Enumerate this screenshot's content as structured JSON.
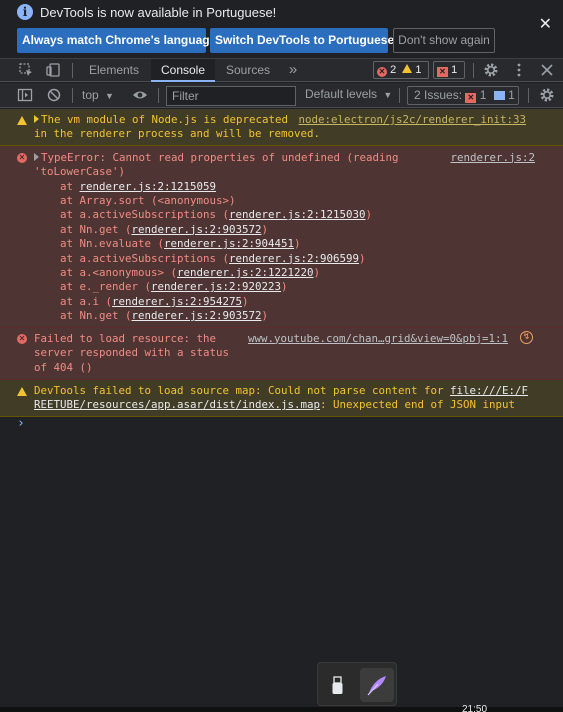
{
  "infobar": {
    "message": "DevTools is now available in Portuguese!",
    "buttons": {
      "always_match": "Always match Chrome's language",
      "switch": "Switch DevTools to Portuguese",
      "dont_show": "Don't show again"
    }
  },
  "tabs": {
    "elements": "Elements",
    "console": "Console",
    "sources": "Sources",
    "more": "»"
  },
  "counts": {
    "errors": "2",
    "warnings": "1",
    "issues_errors": "1"
  },
  "toolbar": {
    "context": "top",
    "filter_placeholder": "Filter",
    "levels": "Default levels",
    "issues_label": "2 Issues:",
    "issues_err": "1",
    "issues_info": "1"
  },
  "messages": {
    "vm_warning": {
      "text_line1": "The vm module of Node.js is deprecated",
      "text_line2": "in the renderer process and will be removed.",
      "source": "node:electron/js2c/renderer_init:33"
    },
    "type_error": {
      "line1": "TypeError: Cannot read properties of undefined (reading",
      "line2": "'toLowerCase')",
      "source": "renderer.js:2",
      "stack": [
        {
          "prefix": "at ",
          "link": "renderer.js:2:1215059",
          "suffix": ""
        },
        {
          "prefix": "at Array.sort (<anonymous>)",
          "link": "",
          "suffix": ""
        },
        {
          "prefix": "at a.activeSubscriptions (",
          "link": "renderer.js:2:1215030",
          "suffix": ")"
        },
        {
          "prefix": "at Nn.get (",
          "link": "renderer.js:2:903572",
          "suffix": ")"
        },
        {
          "prefix": "at Nn.evaluate (",
          "link": "renderer.js:2:904451",
          "suffix": ")"
        },
        {
          "prefix": "at a.activeSubscriptions (",
          "link": "renderer.js:2:906599",
          "suffix": ")"
        },
        {
          "prefix": "at a.<anonymous> (",
          "link": "renderer.js:2:1221220",
          "suffix": ")"
        },
        {
          "prefix": "at e._render (",
          "link": "renderer.js:2:920223",
          "suffix": ")"
        },
        {
          "prefix": "at a.i (",
          "link": "renderer.js:2:954275",
          "suffix": ")"
        },
        {
          "prefix": "at Nn.get (",
          "link": "renderer.js:2:903572",
          "suffix": ")"
        }
      ]
    },
    "resource_error": {
      "line1": "Failed to load resource: the",
      "line2": "server responded with a status",
      "line3": "of 404 ()",
      "source": "www.youtube.com/chan…grid&view=0&pbj=1:1"
    },
    "sourcemap_warning": {
      "line1_text": "DevTools failed to load source map: Could not parse content for ",
      "line1_link": "file:///E:/F",
      "line2_link": "REETUBE/resources/app.asar/dist/index.js.map",
      "line2_text": ": Unexpected end of JSON input"
    }
  },
  "prompt": "›",
  "clock": "21:50",
  "colors": {
    "accent": "#8ab4f8",
    "error": "#f28b82",
    "warning": "#f2c331",
    "button": "#2a6ebd"
  }
}
